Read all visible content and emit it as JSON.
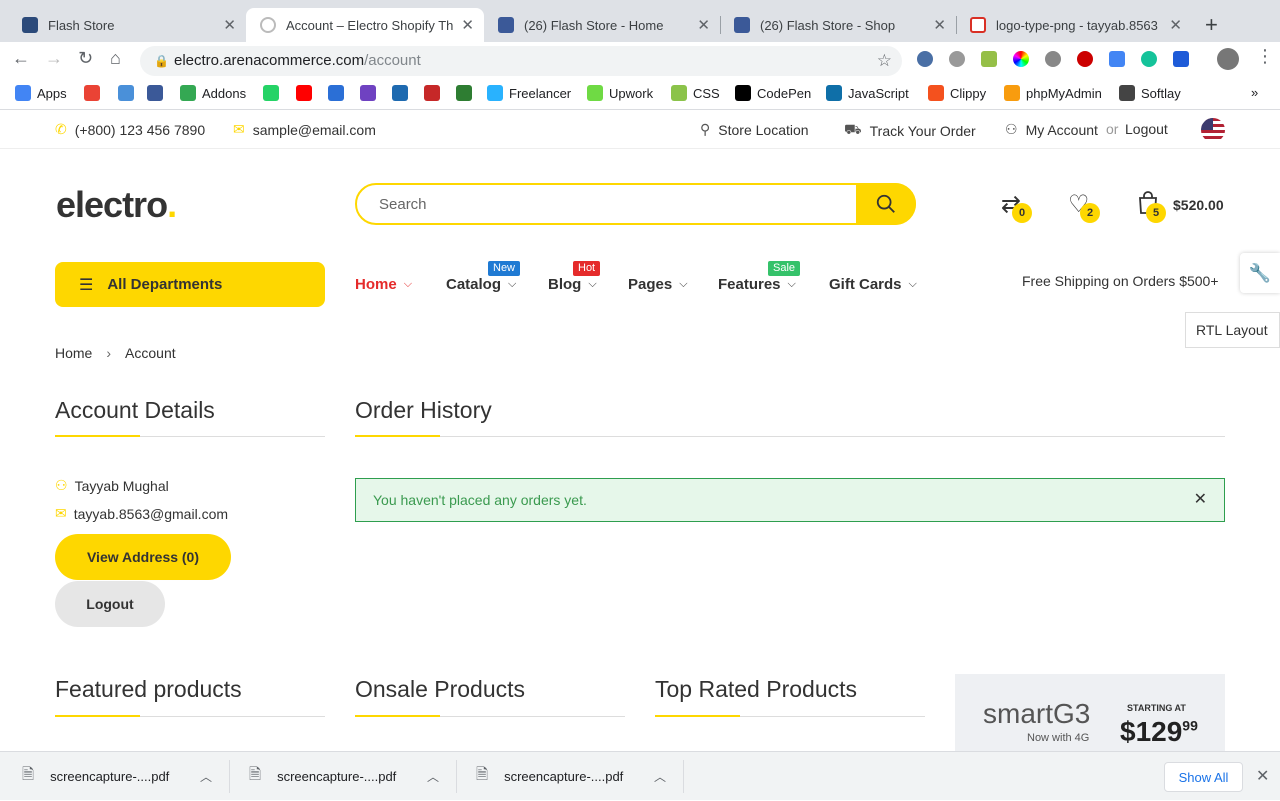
{
  "browser": {
    "tabs": [
      {
        "title": "Flash Store",
        "icon": "react-icon",
        "color": "#61dafb"
      },
      {
        "title": "Account – Electro Shopify Ther",
        "icon": "loading-icon",
        "color": "#fed700"
      },
      {
        "title": "(26) Flash Store - Home",
        "icon": "facebook-icon",
        "color": "#3b5998"
      },
      {
        "title": "(26) Flash Store - Shop",
        "icon": "facebook-icon",
        "color": "#3b5998"
      },
      {
        "title": "logo-type-png - tayyab.8563",
        "icon": "gmail-icon",
        "color": "#d93025"
      }
    ],
    "url_host": "electro.arenacommerce.com",
    "url_path": "/account",
    "bookmarks": [
      {
        "label": "Apps",
        "color": "#4285f4"
      },
      {
        "label": "",
        "color": "#ea4335"
      },
      {
        "label": "",
        "color": "#4a90d9"
      },
      {
        "label": "",
        "color": "#3b5998"
      },
      {
        "label": "Addons",
        "color": "#34a853"
      },
      {
        "label": "",
        "color": "#25d366"
      },
      {
        "label": "",
        "color": "#ff0000"
      },
      {
        "label": "",
        "color": "#2b6fd6"
      },
      {
        "label": "",
        "color": "#6f42c1"
      },
      {
        "label": "",
        "color": "#1e6ab0"
      },
      {
        "label": "",
        "color": "#c62828"
      },
      {
        "label": "",
        "color": "#2e7d32"
      },
      {
        "label": "Freelancer",
        "color": "#29b2fe"
      },
      {
        "label": "Upwork",
        "color": "#6fda44"
      },
      {
        "label": "CSS",
        "color": "#8bc34a"
      },
      {
        "label": "CodePen",
        "color": "#000000"
      },
      {
        "label": "JavaScript",
        "color": "#0f6fa8"
      },
      {
        "label": "Clippy",
        "color": "#f4511e"
      },
      {
        "label": "phpMyAdmin",
        "color": "#f89c0e"
      },
      {
        "label": "Softlay",
        "color": "#444444"
      }
    ],
    "downloads": [
      "screencapture-....pdf",
      "screencapture-....pdf",
      "screencapture-....pdf"
    ],
    "show_all": "Show All"
  },
  "topbar": {
    "phone": "(+800) 123 456 7890",
    "email": "sample@email.com",
    "store_location": "Store Location",
    "track_order": "Track Your Order",
    "my_account": "My Account",
    "or": "or",
    "logout": "Logout"
  },
  "header": {
    "logo": "electro",
    "logo_dot": ".",
    "search_placeholder": "Search",
    "compare_count": "0",
    "wishlist_count": "2",
    "cart_count": "5",
    "cart_total": "$520.00"
  },
  "nav": {
    "departments": "All Departments",
    "items": [
      {
        "label": "Home",
        "badge": ""
      },
      {
        "label": "Catalog",
        "badge": "New"
      },
      {
        "label": "Blog",
        "badge": "Hot"
      },
      {
        "label": "Pages",
        "badge": ""
      },
      {
        "label": "Features",
        "badge": "Sale"
      },
      {
        "label": "Gift Cards",
        "badge": ""
      }
    ],
    "free_shipping": "Free Shipping on Orders $500+",
    "rtl": "RTL Layout"
  },
  "breadcrumb": {
    "home": "Home",
    "current": "Account"
  },
  "account": {
    "title": "Account Details",
    "name": "Tayyab Mughal",
    "email": "tayyab.8563@gmail.com",
    "view_address": "View Address (0)",
    "logout": "Logout"
  },
  "orders": {
    "title": "Order History",
    "empty_message": "You haven't placed any orders yet."
  },
  "bottom": {
    "featured": "Featured products",
    "onsale": "Onsale Products",
    "toprated": "Top Rated Products",
    "promo_brand": "smartG3",
    "promo_sub": "Now with 4G",
    "promo_starting": "STARTING AT",
    "promo_price": "$129",
    "promo_cents": "99"
  },
  "colors": {
    "accent": "#fed700",
    "red": "#e52b2b",
    "success": "#3a9a4f"
  }
}
